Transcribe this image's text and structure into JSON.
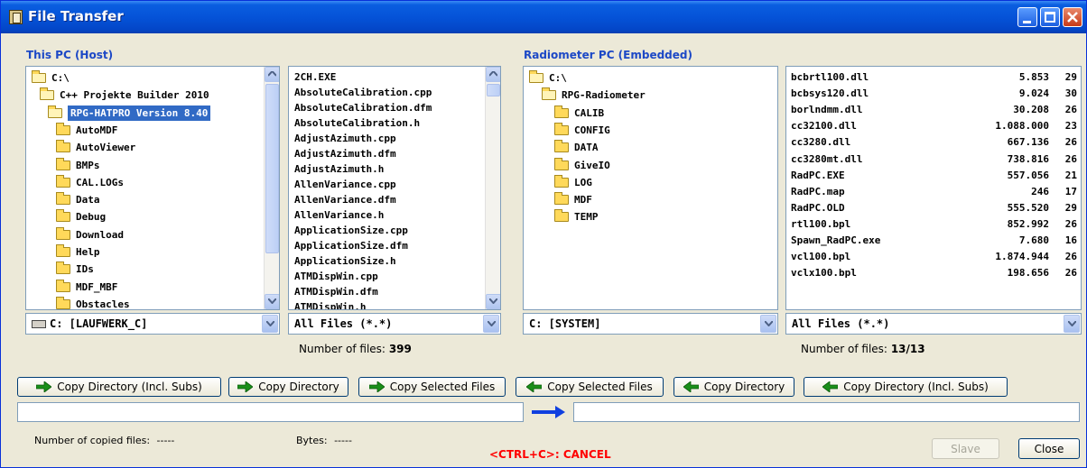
{
  "window": {
    "title": "File Transfer"
  },
  "host": {
    "label": "This PC (Host)",
    "tree": [
      {
        "name": "C:\\",
        "open": true,
        "level": 0,
        "selected": false
      },
      {
        "name": "C++ Projekte Builder 2010",
        "open": true,
        "level": 1,
        "selected": false
      },
      {
        "name": "RPG-HATPRO Version 8.40",
        "open": true,
        "level": 2,
        "selected": true
      },
      {
        "name": "AutoMDF",
        "open": false,
        "level": 3,
        "selected": false
      },
      {
        "name": "AutoViewer",
        "open": false,
        "level": 3,
        "selected": false
      },
      {
        "name": "BMPs",
        "open": false,
        "level": 3,
        "selected": false
      },
      {
        "name": "CAL.LOGs",
        "open": false,
        "level": 3,
        "selected": false
      },
      {
        "name": "Data",
        "open": false,
        "level": 3,
        "selected": false
      },
      {
        "name": "Debug",
        "open": false,
        "level": 3,
        "selected": false
      },
      {
        "name": "Download",
        "open": false,
        "level": 3,
        "selected": false
      },
      {
        "name": "Help",
        "open": false,
        "level": 3,
        "selected": false
      },
      {
        "name": "IDs",
        "open": false,
        "level": 3,
        "selected": false
      },
      {
        "name": "MDF_MBF",
        "open": false,
        "level": 3,
        "selected": false
      },
      {
        "name": "Obstacles",
        "open": false,
        "level": 3,
        "selected": false
      }
    ],
    "files": [
      "2CH.EXE",
      "AbsoluteCalibration.cpp",
      "AbsoluteCalibration.dfm",
      "AbsoluteCalibration.h",
      "AdjustAzimuth.cpp",
      "AdjustAzimuth.dfm",
      "AdjustAzimuth.h",
      "AllenVariance.cpp",
      "AllenVariance.dfm",
      "AllenVariance.h",
      "ApplicationSize.cpp",
      "ApplicationSize.dfm",
      "ApplicationSize.h",
      "ATMDispWin.cpp",
      "ATMDispWin.dfm",
      "ATMDispWin.h"
    ],
    "drive": "C: [LAUFWERK_C]",
    "filter": "All Files (*.*)",
    "count_label": "Number of files:",
    "count_value": "399"
  },
  "radiometer": {
    "label": "Radiometer PC (Embedded)",
    "tree": [
      {
        "name": "C:\\",
        "open": true,
        "level": 0,
        "selected": false
      },
      {
        "name": "RPG-Radiometer",
        "open": true,
        "level": 1,
        "selected": false
      },
      {
        "name": "CALIB",
        "open": false,
        "level": 2,
        "selected": false
      },
      {
        "name": "CONFIG",
        "open": false,
        "level": 2,
        "selected": false
      },
      {
        "name": "DATA",
        "open": false,
        "level": 2,
        "selected": false
      },
      {
        "name": "GiveIO",
        "open": false,
        "level": 2,
        "selected": false
      },
      {
        "name": "LOG",
        "open": false,
        "level": 2,
        "selected": false
      },
      {
        "name": "MDF",
        "open": false,
        "level": 2,
        "selected": false
      },
      {
        "name": "TEMP",
        "open": false,
        "level": 2,
        "selected": false
      }
    ],
    "files": [
      {
        "name": "bcbrtl100.dll",
        "size": "5.853",
        "c": "29"
      },
      {
        "name": "bcbsys120.dll",
        "size": "9.024",
        "c": "30"
      },
      {
        "name": "borlndmm.dll",
        "size": "30.208",
        "c": "26"
      },
      {
        "name": "cc32100.dll",
        "size": "1.088.000",
        "c": "23"
      },
      {
        "name": "cc3280.dll",
        "size": "667.136",
        "c": "26"
      },
      {
        "name": "cc3280mt.dll",
        "size": "738.816",
        "c": "26"
      },
      {
        "name": "RadPC.EXE",
        "size": "557.056",
        "c": "21"
      },
      {
        "name": "RadPC.map",
        "size": "246",
        "c": "17"
      },
      {
        "name": "RadPC.OLD",
        "size": "555.520",
        "c": "29"
      },
      {
        "name": "rtl100.bpl",
        "size": "852.992",
        "c": "26"
      },
      {
        "name": "Spawn_RadPC.exe",
        "size": "7.680",
        "c": "16"
      },
      {
        "name": "vcl100.bpl",
        "size": "1.874.944",
        "c": "26"
      },
      {
        "name": "vclx100.bpl",
        "size": "198.656",
        "c": "26"
      }
    ],
    "drive": "C: [SYSTEM]",
    "filter": "All Files (*.*)",
    "count_label": "Number of files:",
    "count_value": "13/13"
  },
  "buttons": {
    "copy_dir_subs_to": "Copy Directory (Incl. Subs)",
    "copy_dir_to": "Copy Directory",
    "copy_sel_to": "Copy Selected Files",
    "copy_sel_from": "Copy Selected Files",
    "copy_dir_from": "Copy Directory",
    "copy_dir_subs_from": "Copy Directory (Incl. Subs)",
    "slave": "Slave",
    "close": "Close"
  },
  "status": {
    "copied_label": "Number of copied files:",
    "copied_value": "-----",
    "bytes_label": "Bytes:",
    "bytes_value": "-----",
    "cancel": "<CTRL+C>: CANCEL"
  },
  "colors": {
    "arrow_green": "#1a8f1a",
    "title_blue": "#0553d8",
    "cancel_red": "#ff0000",
    "selection": "#316ac5"
  },
  "icons": [
    "folder-icon",
    "open-folder-icon",
    "drive-icon",
    "right-arrow-icon",
    "left-arrow-icon",
    "transfer-arrow-icon"
  ]
}
